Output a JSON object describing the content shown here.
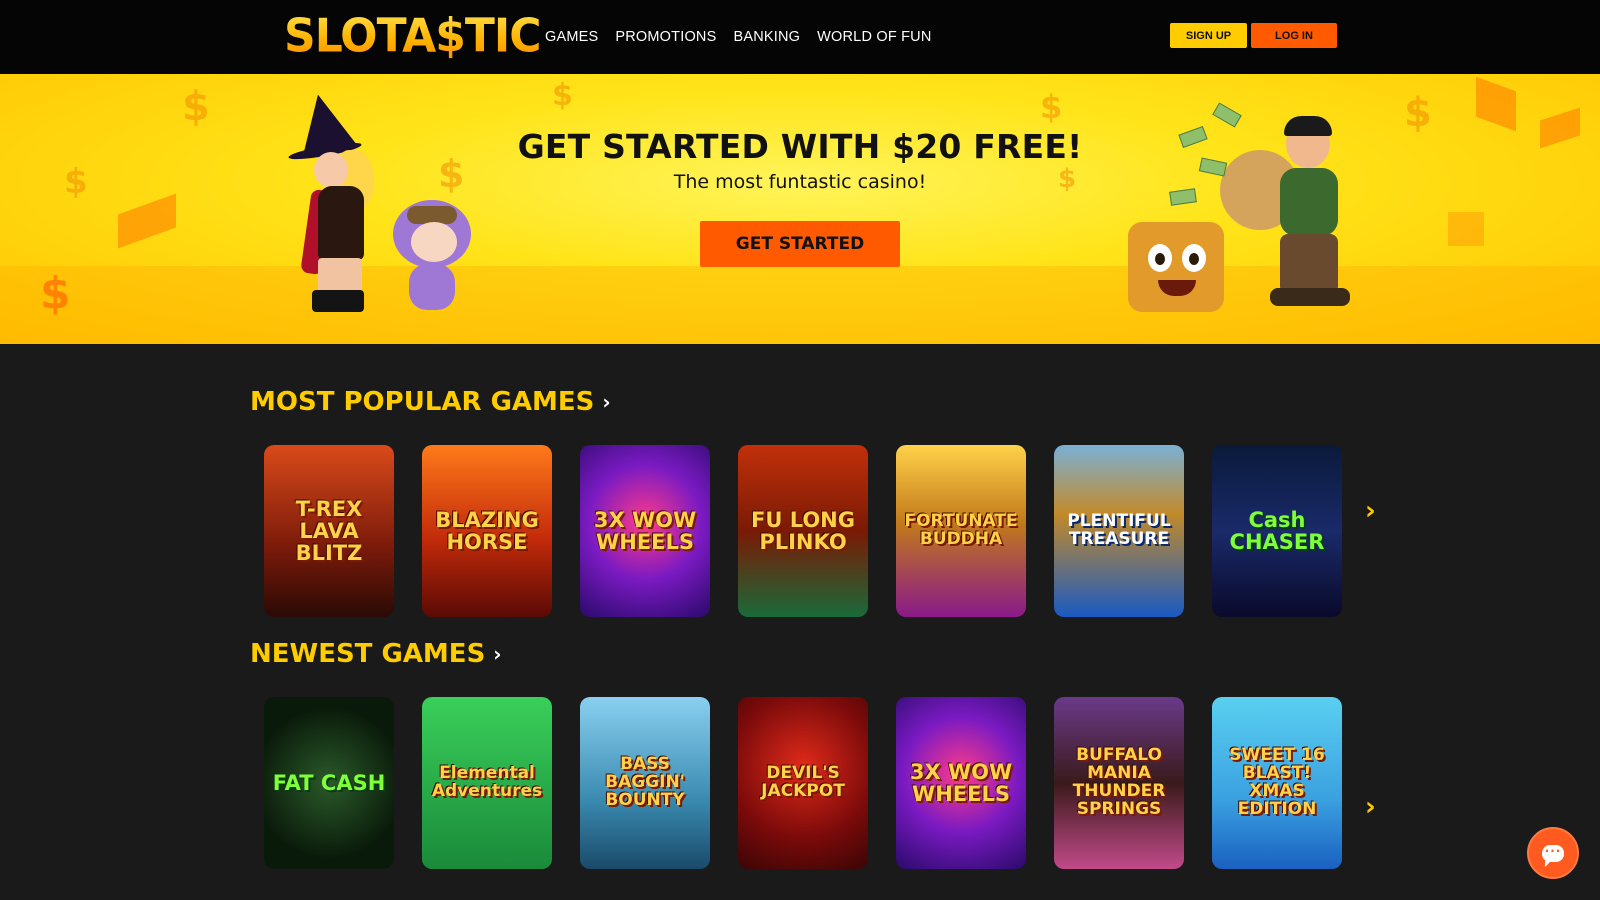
{
  "header": {
    "logo_text": "SLOTA$TIC",
    "nav": [
      "GAMES",
      "PROMOTIONS",
      "BANKING",
      "WORLD OF FUN"
    ],
    "signup_label": "SIGN UP",
    "login_label": "LOG IN",
    "colors": {
      "background": "#050505",
      "signup": "#ffcc00",
      "login": "#ff5a00"
    }
  },
  "banner": {
    "headline": "GET STARTED WITH $20 FREE!",
    "subheadline": "The most funtastic casino!",
    "cta_label": "GET STARTED",
    "colors": {
      "background": "#ffe419",
      "cta": "#ff5a00"
    }
  },
  "sections": [
    {
      "title": "MOST POPULAR GAMES",
      "games": [
        {
          "name": "T-REX LAVA BLITZ",
          "bg": "linear-gradient(180deg,#d94a1a 0%,#7a1a0a 60%,#2a0a05 100%)"
        },
        {
          "name": "BLAZING HORSE",
          "bg": "linear-gradient(180deg,#ff7a1a 0%,#c22a0a 55%,#5a0a05 100%)"
        },
        {
          "name": "3X WOW WHEELS",
          "bg": "radial-gradient(circle at 50% 45%,#ff3a8a 0%,#7a1ac2 50%,#2a0a6a 100%)"
        },
        {
          "name": "FU LONG PLINKO",
          "bg": "linear-gradient(180deg,#c2300a 0%,#7a1a05 50%,#1a6a3a 100%)"
        },
        {
          "name": "FORTUNATE BUDDHA",
          "bg": "linear-gradient(180deg,#ffd24a 0%,#c27a1a 45%,#8a1a8a 100%)"
        },
        {
          "name": "PLENTIFUL TREASURE",
          "bg": "linear-gradient(180deg,#7ab0d6 0%,#c28a2a 40%,#1a5ac2 100%)"
        },
        {
          "name": "Cash CHASER",
          "bg": "linear-gradient(180deg,#0a1a3a 0%,#1a2a6a 50%,#0a0a2a 100%)"
        }
      ]
    },
    {
      "title": "NEWEST GAMES",
      "games": [
        {
          "name": "FAT CASH",
          "bg": "radial-gradient(circle at 50% 50%,#2a5a2a 0%,#0a1a0a 70%)"
        },
        {
          "name": "Elemental Adventures",
          "bg": "linear-gradient(180deg,#3acf5a 0%,#1a8a3a 100%)"
        },
        {
          "name": "BASS BAGGIN' BOUNTY",
          "bg": "linear-gradient(180deg,#8ad0f0 0%,#3a8ab0 60%,#1a4a6a 100%)"
        },
        {
          "name": "DEVIL'S JACKPOT",
          "bg": "radial-gradient(circle at 50% 40%,#e02a1a 0%,#7a0a0a 60%,#3a0505 100%)"
        },
        {
          "name": "3X WOW WHEELS",
          "bg": "radial-gradient(circle at 50% 45%,#ff3a8a 0%,#7a1ac2 50%,#2a0a6a 100%)"
        },
        {
          "name": "BUFFALO MANIA THUNDER SPRINGS",
          "bg": "linear-gradient(180deg,#6a3a8a 0%,#3a1a1a 50%,#c24a8a 100%)"
        },
        {
          "name": "SWEET 16 BLAST! XMAS EDITION",
          "bg": "linear-gradient(180deg,#5ad0f0 0%,#3aa0e0 60%,#1a60c0 100%)"
        }
      ]
    }
  ],
  "icons": {
    "section_chevron": "chevron-right-icon",
    "carousel_next": "chevron-right-icon",
    "chat": "chat-bubble-icon"
  }
}
